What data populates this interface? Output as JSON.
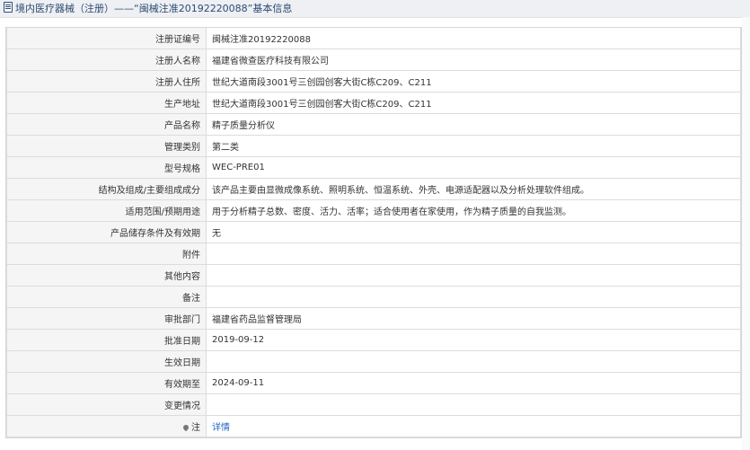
{
  "header": {
    "title": "境内医疗器械（注册）——“闽械注准20192220088”基本信息"
  },
  "rows": [
    {
      "label": "注册证编号",
      "value": "闽械注准20192220088"
    },
    {
      "label": "注册人名称",
      "value": "福建省微查医疗科技有限公司"
    },
    {
      "label": "注册人住所",
      "value": "世纪大道南段3001号三创园创客大街C栋C209、C211"
    },
    {
      "label": "生产地址",
      "value": "世纪大道南段3001号三创园创客大街C栋C209、C211"
    },
    {
      "label": "产品名称",
      "value": "精子质量分析仪"
    },
    {
      "label": "管理类别",
      "value": "第二类"
    },
    {
      "label": "型号规格",
      "value": "WEC-PRE01"
    },
    {
      "label": "结构及组成/主要组成成分",
      "value": "该产品主要由显微成像系统、照明系统、恒温系统、外壳、电源适配器以及分析处理软件组成。"
    },
    {
      "label": "适用范围/预期用途",
      "value": "用于分析精子总数、密度、活力、活率；适合使用者在家使用，作为精子质量的自我监测。"
    },
    {
      "label": "产品储存条件及有效期",
      "value": "无"
    },
    {
      "label": "附件",
      "value": ""
    },
    {
      "label": "其他内容",
      "value": ""
    },
    {
      "label": "备注",
      "value": ""
    },
    {
      "label": "审批部门",
      "value": "福建省药品监督管理局"
    },
    {
      "label": "批准日期",
      "value": "2019-09-12"
    },
    {
      "label": "生效日期",
      "value": ""
    },
    {
      "label": "有效期至",
      "value": "2024-09-11"
    },
    {
      "label": "变更情况",
      "value": ""
    }
  ],
  "note_row": {
    "label": "注",
    "link_text": "详情"
  }
}
